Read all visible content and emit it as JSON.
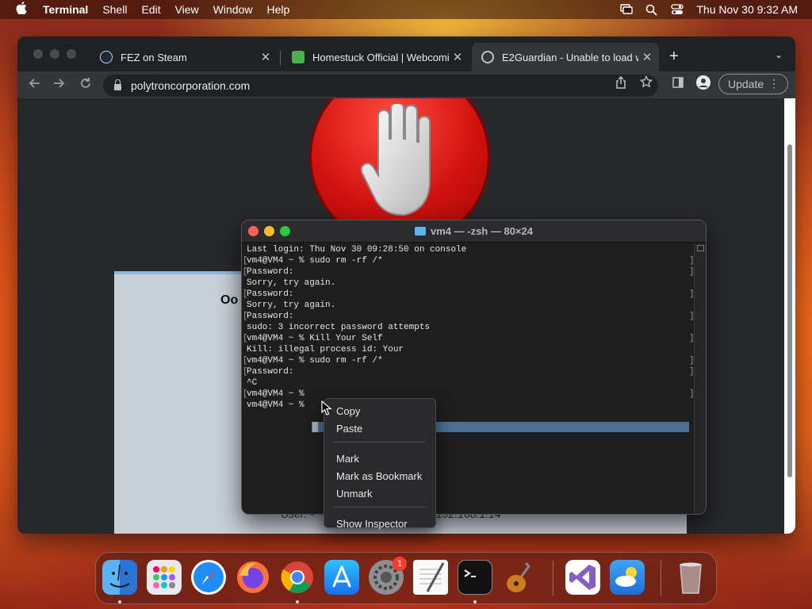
{
  "menubar": {
    "app_name": "Terminal",
    "items": [
      "Shell",
      "Edit",
      "View",
      "Window",
      "Help"
    ],
    "clock": "Thu Nov 30  9:32 AM"
  },
  "browser": {
    "tabs": [
      {
        "title": "FEZ on Steam",
        "icon": "steam-icon"
      },
      {
        "title": "Homestuck Official | Webcomic",
        "icon": "homestuck-icon"
      },
      {
        "title": "E2Guardian - Unable to load w",
        "icon": "globe-icon"
      }
    ],
    "url": "polytroncorporation.com",
    "update_label": "Update",
    "page": {
      "heading": "Oo",
      "user_label": "User: -",
      "ip_text": "192.168.1.14"
    }
  },
  "terminal": {
    "title": "vm4 — -zsh — 80×24",
    "lines": [
      "Last login: Thu Nov 30 09:28:50 on console",
      "vm4@VM4 ~ % sudo rm -rf /*",
      "Password:",
      "Sorry, try again.",
      "Password:",
      "Sorry, try again.",
      "Password:",
      "sudo: 3 incorrect password attempts",
      "vm4@VM4 ~ % Kill Your Self",
      "Kill: illegal process id: Your",
      "vm4@VM4 ~ % sudo rm -rf /*",
      "Password:",
      "^C",
      "vm4@VM4 ~ %",
      "vm4@VM4 ~ %"
    ]
  },
  "context_menu": {
    "items_group1": [
      "Copy",
      "Paste"
    ],
    "items_group2": [
      "Mark",
      "Mark as Bookmark",
      "Unmark"
    ],
    "items_group3": [
      "Show Inspector"
    ]
  },
  "dock": {
    "apps": [
      "finder-icon",
      "launchpad-icon",
      "safari-icon",
      "firefox-icon",
      "chrome-icon",
      "app-store-icon",
      "system-settings-icon",
      "textedit-icon",
      "terminal-icon",
      "garageband-icon",
      "visual-studio-icon",
      "weather-icon",
      "trash-icon"
    ],
    "settings_badge": "1"
  }
}
